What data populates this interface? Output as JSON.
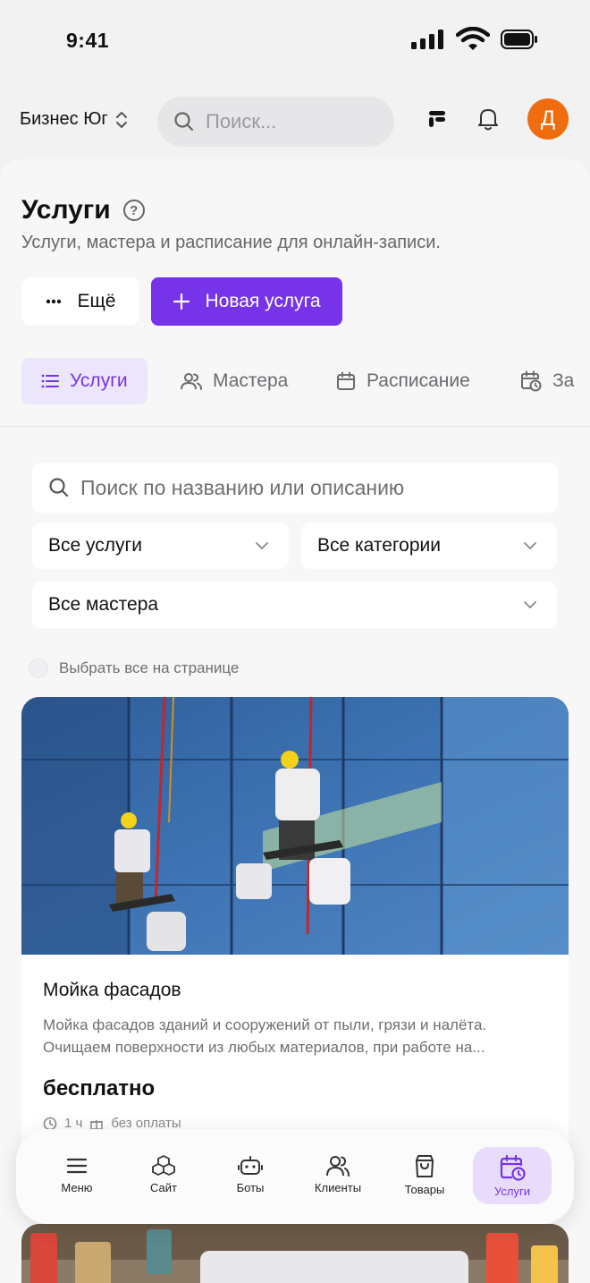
{
  "status": {
    "time": "9:41"
  },
  "header": {
    "workspace": "Бизнес Юг",
    "search_placeholder": "Поиск...",
    "avatar_letter": "Д"
  },
  "page": {
    "title": "Услуги",
    "subtitle": "Услуги, мастера и расписание для онлайн-записи."
  },
  "actions": {
    "more_label": "Ещё",
    "new_service_label": "Новая услуга"
  },
  "tabs": [
    {
      "label": "Услуги",
      "active": true
    },
    {
      "label": "Мастера",
      "active": false
    },
    {
      "label": "Расписание",
      "active": false
    },
    {
      "label": "За",
      "active": false
    }
  ],
  "filters": {
    "search_placeholder": "Поиск по названию или описанию",
    "services_select": "Все услуги",
    "categories_select": "Все категории",
    "masters_select": "Все мастера",
    "select_all_label": "Выбрать все на странице"
  },
  "cards": [
    {
      "title": "Мойка фасадов",
      "description_line1": "Мойка фасадов зданий и сооружений от пыли, грязи и налёта.",
      "description_line2": "Очищаем поверхности из любых материалов, при работе на...",
      "price": "бесплатно",
      "duration": "1 ч",
      "payment": "без оплаты"
    }
  ],
  "bottom_nav": [
    {
      "label": "Меню",
      "icon": "menu-icon"
    },
    {
      "label": "Сайт",
      "icon": "cubes-icon"
    },
    {
      "label": "Боты",
      "icon": "bot-icon"
    },
    {
      "label": "Клиенты",
      "icon": "users-icon"
    },
    {
      "label": "Товары",
      "icon": "bag-icon"
    },
    {
      "label": "Услуги",
      "icon": "calendar-clock-icon",
      "active": true
    }
  ],
  "colors": {
    "accent": "#7633e7",
    "avatar": "#f06d0f"
  }
}
